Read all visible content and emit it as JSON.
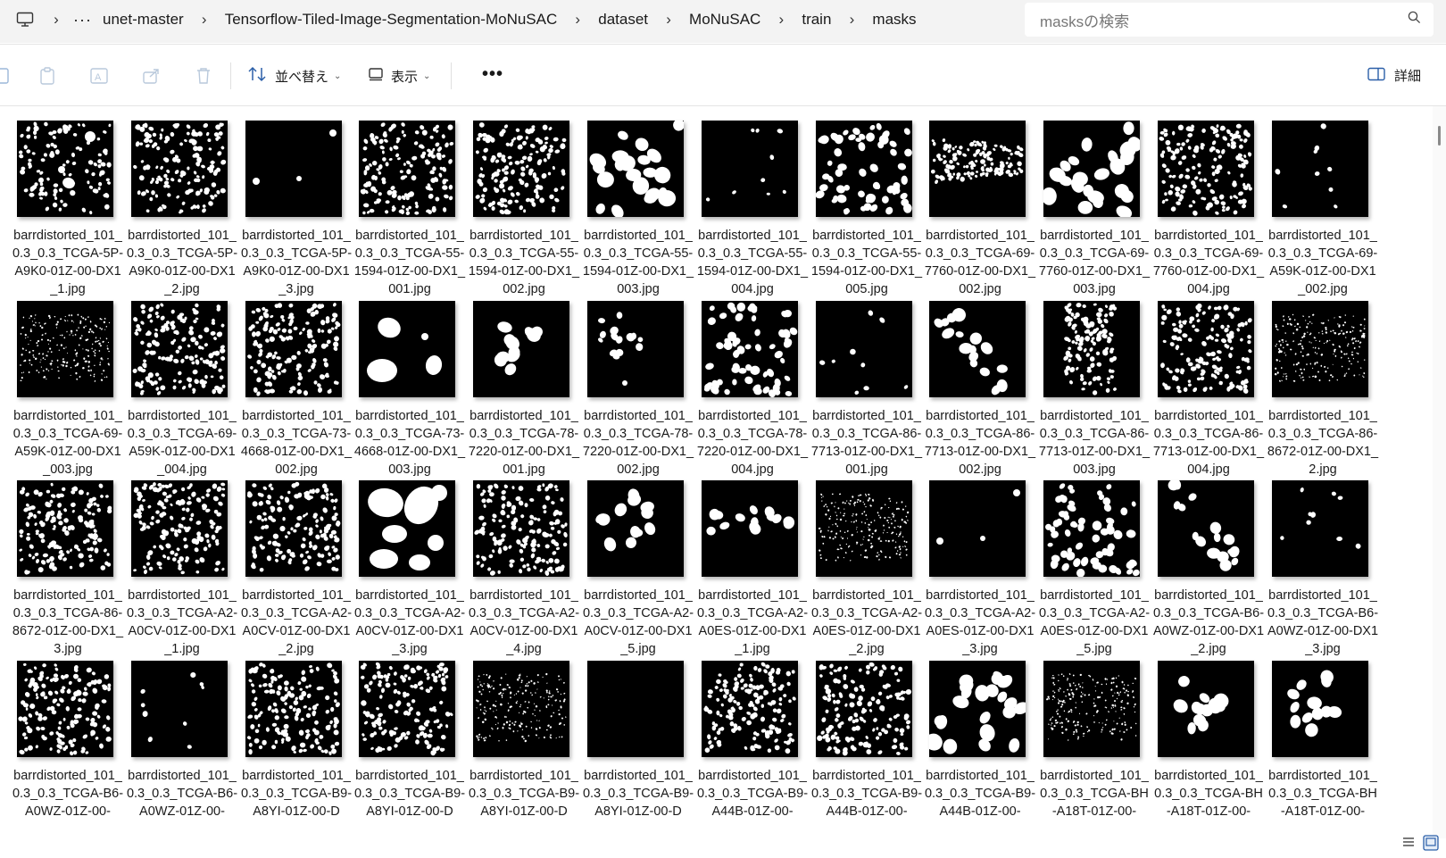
{
  "breadcrumb": {
    "items": [
      "unet-master",
      "Tensorflow-Tiled-Image-Segmentation-MoNuSAC",
      "dataset",
      "MoNuSAC",
      "train",
      "masks"
    ]
  },
  "search": {
    "placeholder": "masksの検索"
  },
  "toolbar": {
    "sort_label": "並べ替え",
    "view_label": "表示",
    "details_label": "詳細"
  },
  "files": [
    {
      "name": "barrdistorted_101_0.3_0.3_TCGA-5P-A9K0-01Z-00-DX1_1.jpg",
      "mask": "dense-mixed"
    },
    {
      "name": "barrdistorted_101_0.3_0.3_TCGA-5P-A9K0-01Z-00-DX1_2.jpg",
      "mask": "dense"
    },
    {
      "name": "barrdistorted_101_0.3_0.3_TCGA-5P-A9K0-01Z-00-DX1_3.jpg",
      "mask": "sparse-two"
    },
    {
      "name": "barrdistorted_101_0.3_0.3_TCGA-55-1594-01Z-00-DX1_001.jpg",
      "mask": "dense"
    },
    {
      "name": "barrdistorted_101_0.3_0.3_TCGA-55-1594-01Z-00-DX1_002.jpg",
      "mask": "dense"
    },
    {
      "name": "barrdistorted_101_0.3_0.3_TCGA-55-1594-01Z-00-DX1_003.jpg",
      "mask": "large-blobs"
    },
    {
      "name": "barrdistorted_101_0.3_0.3_TCGA-55-1594-01Z-00-DX1_004.jpg",
      "mask": "sparse"
    },
    {
      "name": "barrdistorted_101_0.3_0.3_TCGA-55-1594-01Z-00-DX1_005.jpg",
      "mask": "medium"
    },
    {
      "name": "barrdistorted_101_0.3_0.3_TCGA-69-7760-01Z-00-DX1_002.jpg",
      "mask": "band"
    },
    {
      "name": "barrdistorted_101_0.3_0.3_TCGA-69-7760-01Z-00-DX1_003.jpg",
      "mask": "large-blobs"
    },
    {
      "name": "barrdistorted_101_0.3_0.3_TCGA-69-7760-01Z-00-DX1_004.jpg",
      "mask": "dense"
    },
    {
      "name": "barrdistorted_101_0.3_0.3_TCGA-69-A59K-01Z-00-DX1_002.jpg",
      "mask": "sparse"
    },
    {
      "name": "barrdistorted_101_0.3_0.3_TCGA-69-A59K-01Z-00-DX1_003.jpg",
      "mask": "fine-band"
    },
    {
      "name": "barrdistorted_101_0.3_0.3_TCGA-69-A59K-01Z-00-DX1_004.jpg",
      "mask": "dense"
    },
    {
      "name": "barrdistorted_101_0.3_0.3_TCGA-73-4668-01Z-00-DX1_002.jpg",
      "mask": "dense"
    },
    {
      "name": "barrdistorted_101_0.3_0.3_TCGA-73-4668-01Z-00-DX1_003.jpg",
      "mask": "few-large"
    },
    {
      "name": "barrdistorted_101_0.3_0.3_TCGA-78-7220-01Z-00-DX1_001.jpg",
      "mask": "cluster"
    },
    {
      "name": "barrdistorted_101_0.3_0.3_TCGA-78-7220-01Z-00-DX1_002.jpg",
      "mask": "cluster-small"
    },
    {
      "name": "barrdistorted_101_0.3_0.3_TCGA-78-7220-01Z-00-DX1_004.jpg",
      "mask": "medium"
    },
    {
      "name": "barrdistorted_101_0.3_0.3_TCGA-86-7713-01Z-00-DX1_001.jpg",
      "mask": "sparse"
    },
    {
      "name": "barrdistorted_101_0.3_0.3_TCGA-86-7713-01Z-00-DX1_002.jpg",
      "mask": "diagonal"
    },
    {
      "name": "barrdistorted_101_0.3_0.3_TCGA-86-7713-01Z-00-DX1_003.jpg",
      "mask": "column"
    },
    {
      "name": "barrdistorted_101_0.3_0.3_TCGA-86-7713-01Z-00-DX1_004.jpg",
      "mask": "dense"
    },
    {
      "name": "barrdistorted_101_0.3_0.3_TCGA-86-8672-01Z-00-DX1_2.jpg",
      "mask": "fine-band"
    },
    {
      "name": "barrdistorted_101_0.3_0.3_TCGA-86-8672-01Z-00-DX1_3.jpg",
      "mask": "dense"
    },
    {
      "name": "barrdistorted_101_0.3_0.3_TCGA-A2-A0CV-01Z-00-DX1_1.jpg",
      "mask": "dense"
    },
    {
      "name": "barrdistorted_101_0.3_0.3_TCGA-A2-A0CV-01Z-00-DX1_2.jpg",
      "mask": "dense"
    },
    {
      "name": "barrdistorted_101_0.3_0.3_TCGA-A2-A0CV-01Z-00-DX1_3.jpg",
      "mask": "huge"
    },
    {
      "name": "barrdistorted_101_0.3_0.3_TCGA-A2-A0CV-01Z-00-DX1_4.jpg",
      "mask": "dense"
    },
    {
      "name": "barrdistorted_101_0.3_0.3_TCGA-A2-A0CV-01Z-00-DX1_5.jpg",
      "mask": "cluster"
    },
    {
      "name": "barrdistorted_101_0.3_0.3_TCGA-A2-A0ES-01Z-00-DX1_1.jpg",
      "mask": "row"
    },
    {
      "name": "barrdistorted_101_0.3_0.3_TCGA-A2-A0ES-01Z-00-DX1_2.jpg",
      "mask": "fine-band"
    },
    {
      "name": "barrdistorted_101_0.3_0.3_TCGA-A2-A0ES-01Z-00-DX1_3.jpg",
      "mask": "sparse-two"
    },
    {
      "name": "barrdistorted_101_0.3_0.3_TCGA-A2-A0ES-01Z-00-DX1_5.jpg",
      "mask": "medium"
    },
    {
      "name": "barrdistorted_101_0.3_0.3_TCGA-B6-A0WZ-01Z-00-DX1_2.jpg",
      "mask": "diagonal"
    },
    {
      "name": "barrdistorted_101_0.3_0.3_TCGA-B6-A0WZ-01Z-00-DX1_3.jpg",
      "mask": "sparse"
    },
    {
      "name": "barrdistorted_101_0.3_0.3_TCGA-B6-A0WZ-01Z-00-",
      "mask": "dense"
    },
    {
      "name": "barrdistorted_101_0.3_0.3_TCGA-B6-A0WZ-01Z-00-",
      "mask": "sparse"
    },
    {
      "name": "barrdistorted_101_0.3_0.3_TCGA-B9-A8YI-01Z-00-D",
      "mask": "dense"
    },
    {
      "name": "barrdistorted_101_0.3_0.3_TCGA-B9-A8YI-01Z-00-D",
      "mask": "dense"
    },
    {
      "name": "barrdistorted_101_0.3_0.3_TCGA-B9-A8YI-01Z-00-D",
      "mask": "fine-band"
    },
    {
      "name": "barrdistorted_101_0.3_0.3_TCGA-B9-A8YI-01Z-00-D",
      "mask": "empty"
    },
    {
      "name": "barrdistorted_101_0.3_0.3_TCGA-B9-A44B-01Z-00-",
      "mask": "dense"
    },
    {
      "name": "barrdistorted_101_0.3_0.3_TCGA-B9-A44B-01Z-00-",
      "mask": "dense"
    },
    {
      "name": "barrdistorted_101_0.3_0.3_TCGA-B9-A44B-01Z-00-",
      "mask": "large-blobs"
    },
    {
      "name": "barrdistorted_101_0.3_0.3_TCGA-BH-A18T-01Z-00-",
      "mask": "fine-band"
    },
    {
      "name": "barrdistorted_101_0.3_0.3_TCGA-BH-A18T-01Z-00-",
      "mask": "cluster"
    },
    {
      "name": "barrdistorted_101_0.3_0.3_TCGA-BH-A18T-01Z-00-",
      "mask": "cluster"
    }
  ]
}
